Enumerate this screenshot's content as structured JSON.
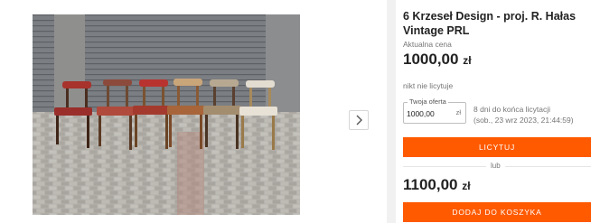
{
  "product": {
    "title": "6 Krzeseł Design - proj. R. Hałas Vintage PRL",
    "current_price_label": "Aktualna cena",
    "current_price_amount": "1000,00",
    "currency": "zł",
    "bids_status": "nikt nie licytuje"
  },
  "gallery": {
    "image_alt": "6 vintage chairs in front of a garage door",
    "next_icon": "chevron-right-icon"
  },
  "bid_form": {
    "legend": "Twoja oferta",
    "value": "1000,00",
    "currency": "zł",
    "time_left": "8 dni do końca licytacji",
    "end_date": "(sob., 23 wrz 2023, 21:44:59)",
    "bid_button": "LICYTUJ"
  },
  "buy_now": {
    "or_label": "lub",
    "price_amount": "1100,00",
    "currency": "zł",
    "cart_button": "DODAJ DO KOSZYKA"
  },
  "colors": {
    "accent": "#ff5a00",
    "muted_text": "#767676"
  }
}
